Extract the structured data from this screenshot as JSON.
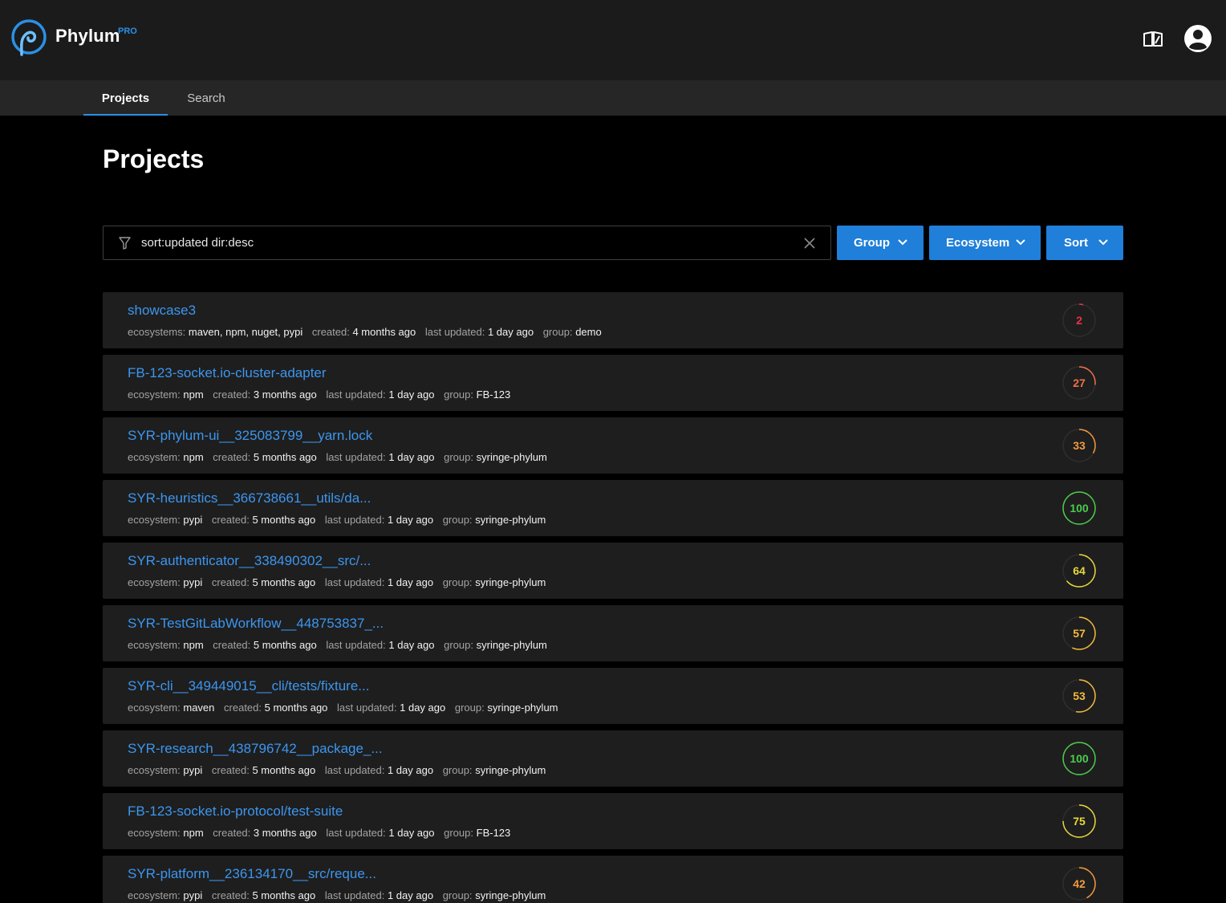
{
  "app": {
    "brand": "Phylum",
    "brand_badge": "PRO"
  },
  "nav": {
    "tabs": [
      {
        "label": "Projects",
        "active": true
      },
      {
        "label": "Search",
        "active": false
      }
    ]
  },
  "page": {
    "title": "Projects"
  },
  "filter": {
    "query": "sort:updated dir:desc",
    "icon": "filter-icon",
    "clear_icon": "close-icon"
  },
  "buttons": {
    "group": "Group",
    "ecosystem": "Ecosystem",
    "sort": "Sort"
  },
  "colors": {
    "accent": "#2b8fe6",
    "button": "#1f7fd9",
    "link": "#3c96f0",
    "score_red": "#e8334a",
    "score_orange": "#f0704a",
    "score_orange_amber": "#f39a3d",
    "score_amber": "#f5bb3a",
    "score_yellow": "#e8d83a",
    "score_green": "#4ccc4c"
  },
  "projects": [
    {
      "name": "showcase3",
      "eco_label": "ecosystems:",
      "ecosystem": "maven, npm, nuget, pypi",
      "created": "4 months ago",
      "updated": "1 day ago",
      "group": "demo",
      "score": 2,
      "score_color": "#e8334a"
    },
    {
      "name": "FB-123-socket.io-cluster-adapter",
      "eco_label": "ecosystem:",
      "ecosystem": "npm",
      "created": "3 months ago",
      "updated": "1 day ago",
      "group": "FB-123",
      "score": 27,
      "score_color": "#f0704a"
    },
    {
      "name": "SYR-phylum-ui__325083799__yarn.lock",
      "eco_label": "ecosystem:",
      "ecosystem": "npm",
      "created": "5 months ago",
      "updated": "1 day ago",
      "group": "syringe-phylum",
      "score": 33,
      "score_color": "#f39a3d"
    },
    {
      "name": "SYR-heuristics__366738661__utils/da...",
      "eco_label": "ecosystem:",
      "ecosystem": "pypi",
      "created": "5 months ago",
      "updated": "1 day ago",
      "group": "syringe-phylum",
      "score": 100,
      "score_color": "#4ccc4c"
    },
    {
      "name": "SYR-authenticator__338490302__src/...",
      "eco_label": "ecosystem:",
      "ecosystem": "pypi",
      "created": "5 months ago",
      "updated": "1 day ago",
      "group": "syringe-phylum",
      "score": 64,
      "score_color": "#e8d83a"
    },
    {
      "name": "SYR-TestGitLabWorkflow__448753837_...",
      "eco_label": "ecosystem:",
      "ecosystem": "npm",
      "created": "5 months ago",
      "updated": "1 day ago",
      "group": "syringe-phylum",
      "score": 57,
      "score_color": "#f5bb3a"
    },
    {
      "name": "SYR-cli__349449015__cli/tests/fixture...",
      "eco_label": "ecosystem:",
      "ecosystem": "maven",
      "created": "5 months ago",
      "updated": "1 day ago",
      "group": "syringe-phylum",
      "score": 53,
      "score_color": "#f5bb3a"
    },
    {
      "name": "SYR-research__438796742__package_...",
      "eco_label": "ecosystem:",
      "ecosystem": "pypi",
      "created": "5 months ago",
      "updated": "1 day ago",
      "group": "syringe-phylum",
      "score": 100,
      "score_color": "#4ccc4c"
    },
    {
      "name": "FB-123-socket.io-protocol/test-suite",
      "eco_label": "ecosystem:",
      "ecosystem": "npm",
      "created": "3 months ago",
      "updated": "1 day ago",
      "group": "FB-123",
      "score": 75,
      "score_color": "#e8d83a"
    },
    {
      "name": "SYR-platform__236134170__src/reque...",
      "eco_label": "ecosystem:",
      "ecosystem": "pypi",
      "created": "5 months ago",
      "updated": "1 day ago",
      "group": "syringe-phylum",
      "score": 42,
      "score_color": "#f39a3d"
    }
  ],
  "meta_labels": {
    "created": "created:",
    "updated": "last updated:",
    "group": "group:"
  }
}
